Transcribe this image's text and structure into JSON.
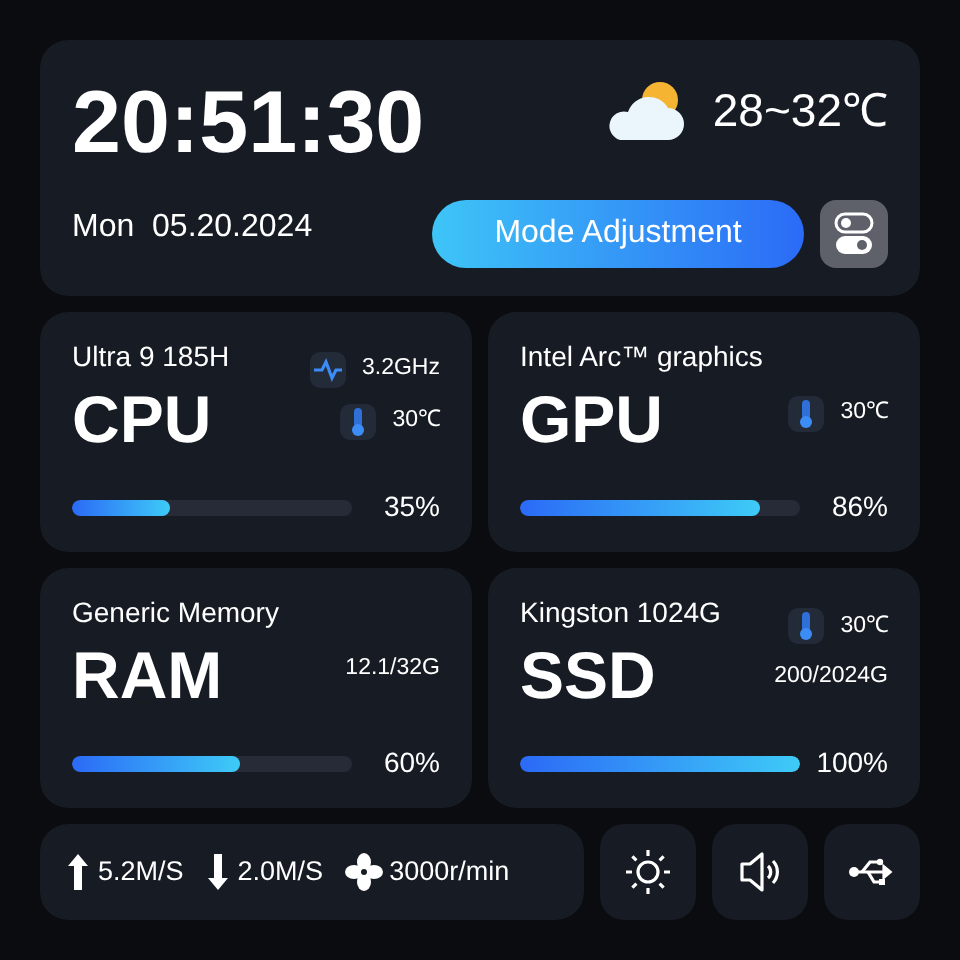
{
  "header": {
    "time": "20:51:30",
    "date": "Mon  05.20.2024",
    "temperature": "28~32℃",
    "mode_button": "Mode Adjustment"
  },
  "cards": [
    {
      "subtitle": "Ultra 9 185H",
      "title": "CPU",
      "stats": [
        {
          "kind": "frequency",
          "text": "3.2GHz"
        },
        {
          "kind": "temperature",
          "text": "30℃"
        }
      ],
      "level": 0.35,
      "percent": "35%"
    },
    {
      "subtitle": "Intel Arc™ graphics",
      "title": "GPU",
      "stats": [
        {
          "kind": "temperature",
          "text": "30℃"
        }
      ],
      "level": 0.86,
      "percent": "86%"
    },
    {
      "subtitle": "Generic Memory",
      "title": "RAM",
      "stats": [
        {
          "kind": "capacity",
          "text": "12.1/32G"
        }
      ],
      "level": 0.6,
      "percent": "60%"
    },
    {
      "subtitle": "Kingston 1024G",
      "title": "SSD",
      "stats": [
        {
          "kind": "temperature",
          "text": "30℃"
        },
        {
          "kind": "capacity",
          "text": "200/2024G"
        }
      ],
      "level": 1,
      "percent": "100%"
    }
  ],
  "status": [
    {
      "kind": "upload",
      "text": "5.2M/S"
    },
    {
      "kind": "download",
      "text": "2.0M/S"
    },
    {
      "kind": "fan",
      "text": "3000r/min"
    }
  ],
  "quick_buttons": [
    {
      "kind": "brightness"
    },
    {
      "kind": "volume"
    },
    {
      "kind": "usb"
    }
  ]
}
